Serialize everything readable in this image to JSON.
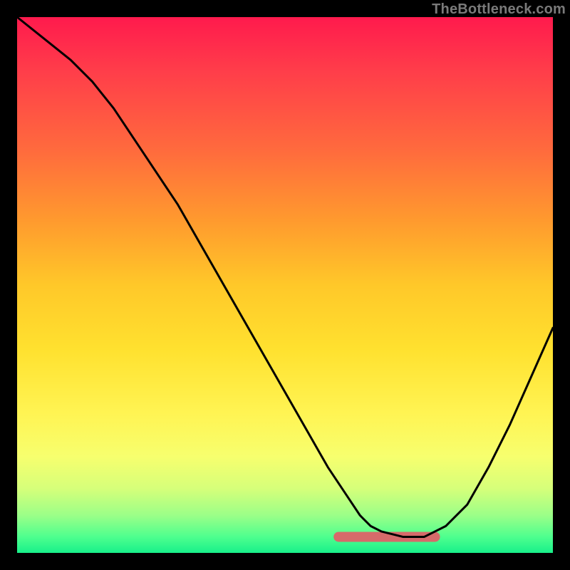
{
  "attribution": "TheBottleneck.com",
  "colors": {
    "page_bg": "#000000",
    "curve": "#000000",
    "highlight": "#d66a6a",
    "gradient_top": "#ff1a4d",
    "gradient_bottom": "#18f08a"
  },
  "chart_data": {
    "type": "line",
    "title": "",
    "xlabel": "",
    "ylabel": "",
    "xlim": [
      0,
      100
    ],
    "ylim": [
      0,
      100
    ],
    "grid": false,
    "legend": false,
    "series": [
      {
        "name": "curve",
        "x": [
          0,
          5,
          10,
          14,
          18,
          22,
          26,
          30,
          34,
          38,
          42,
          46,
          50,
          54,
          58,
          62,
          64,
          66,
          68,
          72,
          76,
          80,
          84,
          88,
          92,
          96,
          100
        ],
        "y": [
          100,
          96,
          92,
          88,
          83,
          77,
          71,
          65,
          58,
          51,
          44,
          37,
          30,
          23,
          16,
          10,
          7,
          5,
          4,
          3,
          3,
          5,
          9,
          16,
          24,
          33,
          42
        ]
      }
    ],
    "annotations": [
      {
        "name": "minimum-highlight",
        "x_range": [
          60,
          78
        ],
        "y": 3,
        "note": "short pink stroke marking the curve's minimum plateau"
      }
    ]
  }
}
